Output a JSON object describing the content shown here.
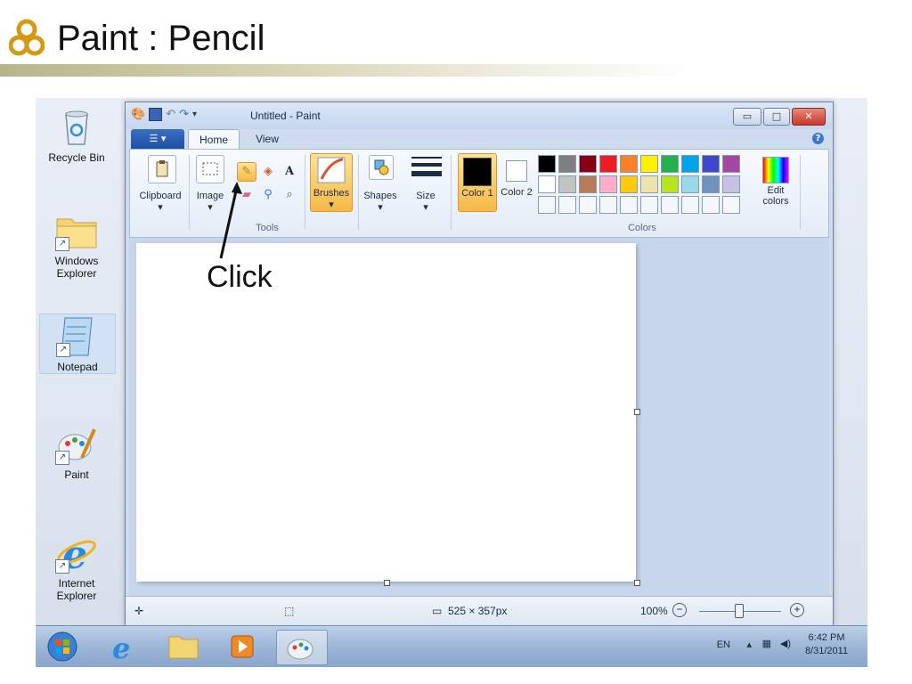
{
  "slide": {
    "title": "Paint : Pencil",
    "bullet_color": "#d39b14",
    "annotation": "Click"
  },
  "desktop": {
    "icons": [
      {
        "label": "Recycle Bin",
        "icon": "recycle-bin-icon"
      },
      {
        "label": "Windows Explorer",
        "icon": "folder-icon"
      },
      {
        "label": "Notepad",
        "icon": "notepad-icon"
      },
      {
        "label": "Paint",
        "icon": "paint-palette-icon"
      },
      {
        "label": "Internet Explorer",
        "icon": "ie-icon"
      }
    ]
  },
  "window": {
    "title": "Untitled - Paint",
    "tabs": [
      "Home",
      "View"
    ],
    "groups": {
      "clipboard": "Clipboard",
      "image": "Image",
      "tools": "Tools",
      "brushes": "Brushes",
      "shapes": "Shapes",
      "size": "Size",
      "color1": "Color 1",
      "color2": "Color 2",
      "colors": "Colors",
      "edit_colors": "Edit colors"
    },
    "palette_row1": [
      "#000000",
      "#7f7f7f",
      "#880015",
      "#ed1c24",
      "#ff7f27",
      "#fff200",
      "#22b14c",
      "#00a2e8",
      "#3f48cc",
      "#a349a4"
    ],
    "palette_row2": [
      "#ffffff",
      "#c3c3c3",
      "#b97a57",
      "#ffaec9",
      "#ffc90e",
      "#efe4b0",
      "#b5e61d",
      "#99d9ea",
      "#7092be",
      "#c8bfe7"
    ],
    "status": {
      "size": "525 × 357px",
      "zoom": "100%"
    }
  },
  "taskbar": {
    "language": "EN",
    "time": "6:42 PM",
    "date": "8/31/2011"
  }
}
